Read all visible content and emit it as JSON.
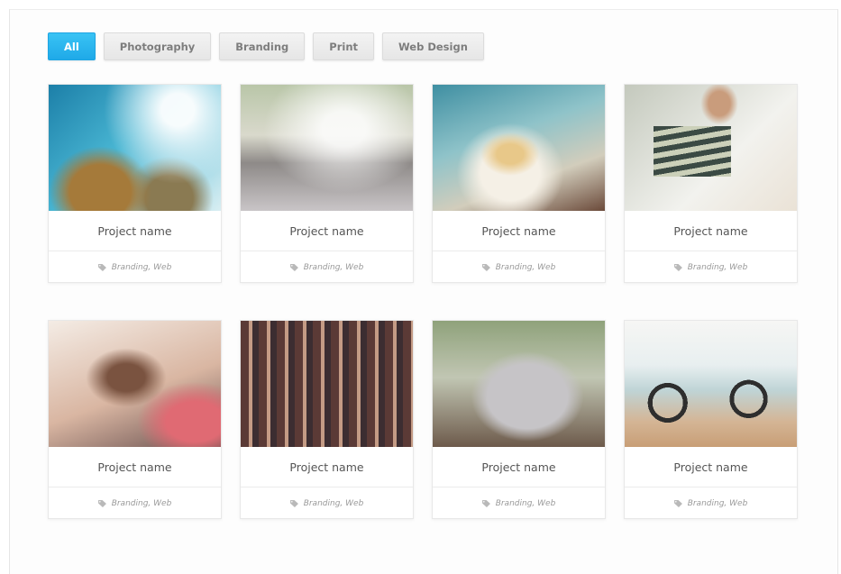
{
  "filters": [
    {
      "label": "All",
      "active": true
    },
    {
      "label": "Photography",
      "active": false
    },
    {
      "label": "Branding",
      "active": false
    },
    {
      "label": "Print",
      "active": false
    },
    {
      "label": "Web Design",
      "active": false
    }
  ],
  "colors": {
    "accent": "#2ab4ee",
    "filter_bg": "#ececec",
    "text": "#555555",
    "meta_text": "#9a9a9a"
  },
  "projects": [
    {
      "name": "Project name",
      "tags": "Branding, Web",
      "icon": "tag-icon"
    },
    {
      "name": "Project name",
      "tags": "Branding, Web",
      "icon": "tag-icon"
    },
    {
      "name": "Project name",
      "tags": "Branding, Web",
      "icon": "tag-icon"
    },
    {
      "name": "Project name",
      "tags": "Branding, Web",
      "icon": "tag-icon"
    },
    {
      "name": "Project name",
      "tags": "Branding, Web",
      "icon": "tag-icon"
    },
    {
      "name": "Project name",
      "tags": "Branding, Web",
      "icon": "tag-icon"
    },
    {
      "name": "Project name",
      "tags": "Branding, Web",
      "icon": "tag-icon"
    },
    {
      "name": "Project name",
      "tags": "Branding, Web",
      "icon": "tag-icon"
    }
  ]
}
